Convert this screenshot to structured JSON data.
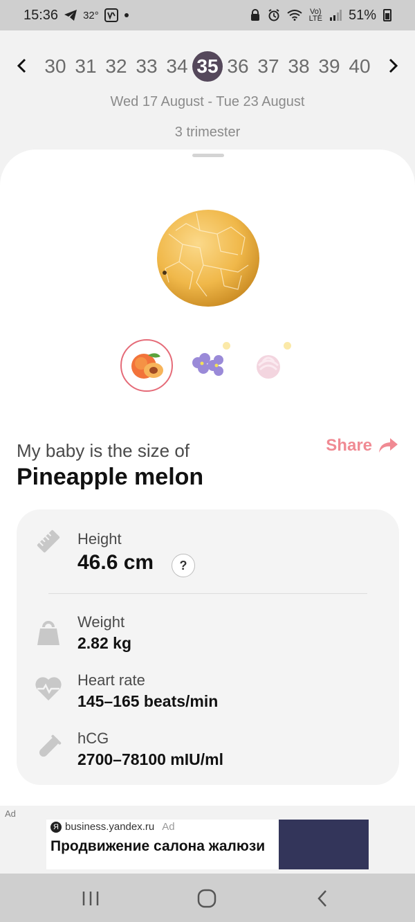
{
  "status_bar": {
    "time": "15:36",
    "temperature": "32°",
    "battery": "51%",
    "network": "LTE",
    "icons": [
      "telegram-icon",
      "weather-icon",
      "dot-icon",
      "lock-icon",
      "alarm-icon",
      "wifi-icon",
      "volte-icon",
      "signal-icon",
      "battery-icon"
    ]
  },
  "week_nav": {
    "weeks": [
      "30",
      "31",
      "32",
      "33",
      "34",
      "35",
      "36",
      "37",
      "38",
      "39",
      "40"
    ],
    "selected": "35"
  },
  "date_range": "Wed 17 August - Tue 23 August",
  "trimester": "3 trimester",
  "comparison": {
    "options": [
      "peach-icon",
      "violet-flower-icon",
      "marshmallow-icon"
    ],
    "selected_index": 0
  },
  "size": {
    "intro": "My baby is the size of",
    "name": "Pineapple melon",
    "share_label": "Share"
  },
  "stats": {
    "height": {
      "label": "Height",
      "value": "46.6 cm",
      "help": "?"
    },
    "weight": {
      "label": "Weight",
      "value": "2.82 kg"
    },
    "heart_rate": {
      "label": "Heart rate",
      "value": "145–165 beats/min"
    },
    "hcg": {
      "label": "hCG",
      "value": "2700–78100 mIU/ml"
    }
  },
  "ad": {
    "tag": "Ad",
    "logo": "Я",
    "domain": "business.yandex.ru",
    "label": "Ad",
    "title": "Продвижение салона жалюзи"
  },
  "colors": {
    "accent": "#f08a93",
    "selected_week": "#55485b",
    "card": "#f4f4f4"
  }
}
